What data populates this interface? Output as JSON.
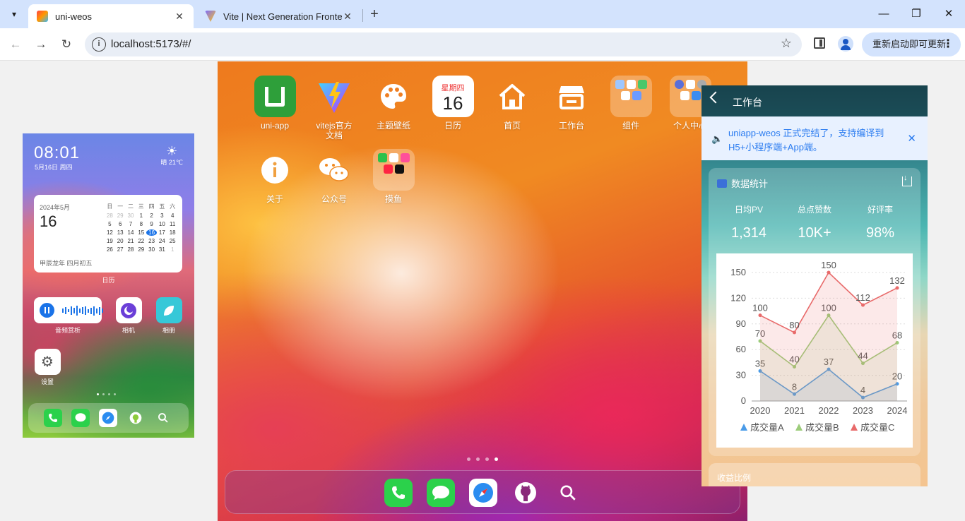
{
  "browser": {
    "tabs": [
      {
        "title": "uni-weos"
      },
      {
        "title": "Vite | Next Generation Fronte"
      }
    ],
    "url": "localhost:5173/#/",
    "update_label": "重新启动即可更新"
  },
  "desktop": {
    "apps": [
      {
        "label": "uni-app"
      },
      {
        "label": "vitejs官方\n文档"
      },
      {
        "label": "主题壁纸"
      },
      {
        "label": "日历",
        "weekday": "星期四",
        "day": "16"
      },
      {
        "label": "首页"
      },
      {
        "label": "工作台"
      },
      {
        "label": "组件"
      },
      {
        "label": "个人中心"
      },
      {
        "label": "关于"
      },
      {
        "label": "公众号"
      },
      {
        "label": "摸鱼"
      }
    ],
    "page_count": 4,
    "active_page": 4
  },
  "phone": {
    "time": "08:01",
    "date": "5月16日 周四",
    "weather": "晴 21℃",
    "calendar": {
      "year_month": "2024年5月",
      "day": "16",
      "lunar": "甲辰龙年 四月初五",
      "weekdays": [
        "日",
        "一",
        "二",
        "三",
        "四",
        "五",
        "六"
      ],
      "rows": [
        [
          "28",
          "29",
          "30",
          "1",
          "2",
          "3",
          "4"
        ],
        [
          "5",
          "6",
          "7",
          "8",
          "9",
          "10",
          "11"
        ],
        [
          "12",
          "13",
          "14",
          "15",
          "16",
          "17",
          "18"
        ],
        [
          "19",
          "20",
          "21",
          "22",
          "23",
          "24",
          "25"
        ],
        [
          "26",
          "27",
          "28",
          "29",
          "30",
          "31",
          "1"
        ]
      ],
      "label": "日历"
    },
    "apps": [
      {
        "label": "音频赏析"
      },
      {
        "label": "相机"
      },
      {
        "label": "相册"
      },
      {
        "label": "设置"
      }
    ]
  },
  "panel": {
    "title": "工作台",
    "notice": "uniapp-weos 正式完结了，支持编译到H5+小程序端+App端。",
    "stats_title": "数据统计",
    "stats": [
      {
        "label": "日均PV",
        "value": "1,314"
      },
      {
        "label": "总点赞数",
        "value": "10K+"
      },
      {
        "label": "好评率",
        "value": "98%"
      }
    ],
    "next_title": "收益比例"
  },
  "chart_data": {
    "type": "line",
    "x": [
      "2020",
      "2021",
      "2022",
      "2023",
      "2024"
    ],
    "ylim": [
      0,
      150
    ],
    "yticks": [
      0,
      30,
      60,
      90,
      120,
      150
    ],
    "series": [
      {
        "name": "成交量A",
        "values": [
          35,
          8,
          37,
          4,
          20
        ],
        "color": "#4a9be8"
      },
      {
        "name": "成交量B",
        "values": [
          70,
          40,
          100,
          44,
          68
        ],
        "color": "#9ccc7a"
      },
      {
        "name": "成交量C",
        "values": [
          100,
          80,
          150,
          112,
          132
        ],
        "color": "#e86a6a"
      }
    ],
    "legend": "bottom"
  }
}
